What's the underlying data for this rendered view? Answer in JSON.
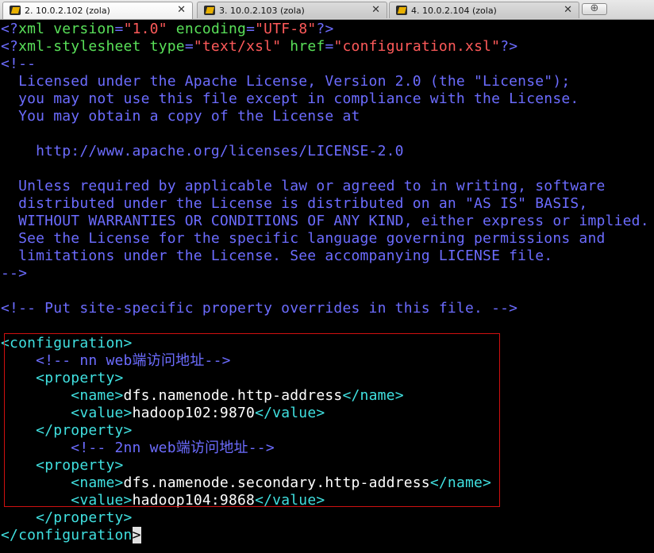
{
  "tabs": [
    {
      "label": "2. 10.0.2.102 (zola)",
      "close": "✕",
      "active": true
    },
    {
      "label": "3. 10.0.2.103 (zola)",
      "close": "✕",
      "active": false
    },
    {
      "label": "4. 10.0.2.104 (zola)",
      "close": "✕",
      "active": false
    }
  ],
  "new_tab_glyph": "⊕",
  "colors": {
    "background": "#000000",
    "processing_instruction": "#6c6cff",
    "attribute": "#59e059",
    "string": "#ff5a5a",
    "comment": "#6c6cff",
    "tag": "#40e0e0",
    "text": "#ffffff",
    "selection_border": "#d01010"
  },
  "editor_lines": [
    [
      [
        "pi",
        "<?"
      ],
      [
        "key",
        "xml"
      ],
      [
        "text",
        " "
      ],
      [
        "key",
        "version"
      ],
      [
        "pi",
        "="
      ],
      [
        "str",
        "\"1.0\""
      ],
      [
        "text",
        " "
      ],
      [
        "key",
        "encoding"
      ],
      [
        "pi",
        "="
      ],
      [
        "str",
        "\"UTF-8\""
      ],
      [
        "pi",
        "?>"
      ]
    ],
    [
      [
        "pi",
        "<?"
      ],
      [
        "key",
        "xml-stylesheet"
      ],
      [
        "text",
        " "
      ],
      [
        "key",
        "type"
      ],
      [
        "pi",
        "="
      ],
      [
        "str",
        "\"text/xsl\""
      ],
      [
        "text",
        " "
      ],
      [
        "key",
        "href"
      ],
      [
        "pi",
        "="
      ],
      [
        "str",
        "\"configuration.xsl\""
      ],
      [
        "pi",
        "?>"
      ]
    ],
    [
      [
        "cmt",
        "<!--"
      ]
    ],
    [
      [
        "cmt",
        "  Licensed under the Apache License, Version 2.0 (the \"License\");"
      ]
    ],
    [
      [
        "cmt",
        "  you may not use this file except in compliance with the License."
      ]
    ],
    [
      [
        "cmt",
        "  You may obtain a copy of the License at"
      ]
    ],
    [],
    [
      [
        "cmt",
        "    http://www.apache.org/licenses/LICENSE-2.0"
      ]
    ],
    [],
    [
      [
        "cmt",
        "  Unless required by applicable law or agreed to in writing, software"
      ]
    ],
    [
      [
        "cmt",
        "  distributed under the License is distributed on an \"AS IS\" BASIS,"
      ]
    ],
    [
      [
        "cmt",
        "  WITHOUT WARRANTIES OR CONDITIONS OF ANY KIND, either express or implied."
      ]
    ],
    [
      [
        "cmt",
        "  See the License for the specific language governing permissions and"
      ]
    ],
    [
      [
        "cmt",
        "  limitations under the License. See accompanying LICENSE file."
      ]
    ],
    [
      [
        "cmt",
        "-->"
      ]
    ],
    [],
    [
      [
        "cmt",
        "<!-- Put site-specific property overrides in this file. -->"
      ]
    ],
    [],
    [
      [
        "tag",
        "<configuration>"
      ]
    ],
    [
      [
        "text",
        "    "
      ],
      [
        "cmt",
        "<!-- nn web端访问地址-->"
      ]
    ],
    [
      [
        "text",
        "    "
      ],
      [
        "tag",
        "<property>"
      ]
    ],
    [
      [
        "text",
        "        "
      ],
      [
        "tag",
        "<name>"
      ],
      [
        "text",
        "dfs.namenode.http-address"
      ],
      [
        "tag",
        "</name>"
      ]
    ],
    [
      [
        "text",
        "        "
      ],
      [
        "tag",
        "<value>"
      ],
      [
        "text",
        "hadoop102:9870"
      ],
      [
        "tag",
        "</value>"
      ]
    ],
    [
      [
        "text",
        "    "
      ],
      [
        "tag",
        "</property>"
      ]
    ],
    [
      [
        "text",
        "        "
      ],
      [
        "cmt",
        "<!-- 2nn web端访问地址-->"
      ]
    ],
    [
      [
        "text",
        "    "
      ],
      [
        "tag",
        "<property>"
      ]
    ],
    [
      [
        "text",
        "        "
      ],
      [
        "tag",
        "<name>"
      ],
      [
        "text",
        "dfs.namenode.secondary.http-address"
      ],
      [
        "tag",
        "</name>"
      ]
    ],
    [
      [
        "text",
        "        "
      ],
      [
        "tag",
        "<value>"
      ],
      [
        "text",
        "hadoop104:9868"
      ],
      [
        "tag",
        "</value>"
      ]
    ],
    [
      [
        "text",
        "    "
      ],
      [
        "tag",
        "</property>"
      ]
    ],
    [
      [
        "tag",
        "</configuration"
      ],
      [
        "cursor",
        ">"
      ]
    ]
  ]
}
